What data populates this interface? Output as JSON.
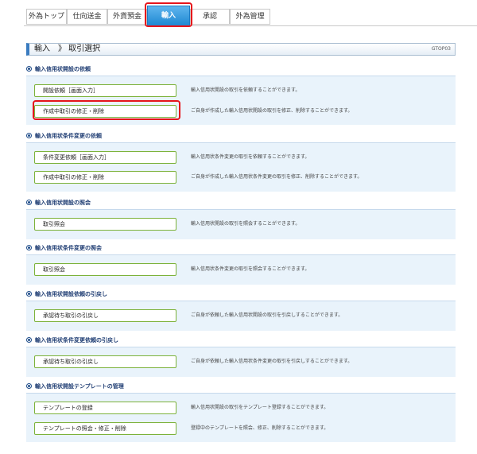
{
  "tabs": [
    "外為トップ",
    "仕向送金",
    "外貨預金",
    "輸入",
    "承認",
    "外為管理"
  ],
  "active_tab": "輸入",
  "page_title": "輸入　》 取引選択",
  "screen_id": "GTOP03",
  "sections": [
    {
      "title": "輸入信用状開設の依頼",
      "items": [
        {
          "label": "開設依頼［画面入力］",
          "desc": "輸入信用状開設の取引を依頼することができます。"
        },
        {
          "label": "作成中取引の修正・削除",
          "desc": "ご自身が作成した輸入信用状開設の取引を修正、削除することができます。"
        }
      ]
    },
    {
      "title": "輸入信用状条件変更の依頼",
      "items": [
        {
          "label": "条件変更依頼［画面入力］",
          "desc": "輸入信用状条件変更の取引を依頼することができます。"
        },
        {
          "label": "作成中取引の修正・削除",
          "desc": "ご自身が作成した輸入信用状条件変更の取引を修正、削除することができます。"
        }
      ]
    },
    {
      "title": "輸入信用状開設の照会",
      "items": [
        {
          "label": "取引照会",
          "desc": "輸入信用状開設の取引を照会することができます。"
        }
      ]
    },
    {
      "title": "輸入信用状条件変更の照会",
      "items": [
        {
          "label": "取引照会",
          "desc": "輸入信用状条件変更の取引を照会することができます。"
        }
      ]
    },
    {
      "title": "輸入信用状開設依頼の引戻し",
      "items": [
        {
          "label": "承認待ち取引の引戻し",
          "desc": "ご自身が依頼した輸入信用状開設の取引を引戻しすることができます。"
        }
      ]
    },
    {
      "title": "輸入信用状条件変更依頼の引戻し",
      "items": [
        {
          "label": "承認待ち取引の引戻し",
          "desc": "ご自身が依頼した輸入信用状条件変更の取引を引戻しすることができます。"
        }
      ]
    },
    {
      "title": "輸入信用状開設テンプレートの管理",
      "items": [
        {
          "label": "テンプレートの登録",
          "desc": "輸入信用状開設の取引をテンプレート登録することができます。"
        },
        {
          "label": "テンプレートの照会・修正・削除",
          "desc": "登録中のテンプレートを照会、修正、削除することができます。"
        }
      ]
    }
  ],
  "colors": {
    "active_tab": "#1e88d2",
    "highlight": "#e6141b",
    "panel": "#e9f3fb",
    "button_border": "#7cb23a",
    "section_title": "#1f3d73"
  }
}
